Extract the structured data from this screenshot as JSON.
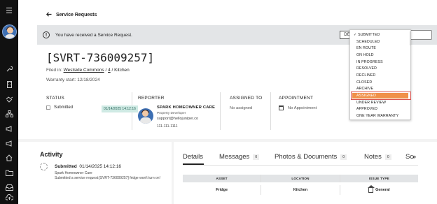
{
  "nav": {
    "items": [
      "menu-icon",
      "wrench-icon",
      "building-icon",
      "handshake-icon",
      "org-chart-icon",
      "megaphone-icon",
      "megaphone-icon",
      "home-icon",
      "folder-icon",
      "inbox-icon",
      "cloud-upload-icon"
    ]
  },
  "header": {
    "back_label": "Service Requests"
  },
  "banner": {
    "message": "You have received a Service Request.",
    "decline_label": "DECLINE"
  },
  "request": {
    "id": "[SVRT-736009257]",
    "filed_in_label": "Filed in:",
    "community": "Westside Commons",
    "unit": "4",
    "room": "Kitchen",
    "warranty_label": "Warranty start:",
    "warranty_date": "12/18/2024"
  },
  "cards": {
    "status_header": "STATUS",
    "status_value": "Submitted",
    "status_date": "01/14/2025 14:12:16",
    "reporter_header": "REPORTER",
    "reporter_name": "SPARK HOMEOWNER CARE",
    "reporter_role": "Property Developer",
    "reporter_email": "support@hellojuniper.co",
    "reporter_phone": "111-111-1111",
    "assigned_header": "ASSIGNED TO",
    "assigned_value": "No assigned",
    "appointment_header": "APPOINTMENT",
    "appointment_value": "No Appointment"
  },
  "activity": {
    "title": "Activity",
    "status": "Submitted",
    "timestamp": "01/14/2025 14:12:16",
    "actor": "Spark Homeowner Care",
    "description": "Submitted a service request:[SVRT-736009257] fridge won't turn on!"
  },
  "tabs": [
    {
      "label": "Details",
      "count": ""
    },
    {
      "label": "Messages",
      "count": "0"
    },
    {
      "label": "Photos & Documents",
      "count": "0"
    },
    {
      "label": "Notes",
      "count": "0"
    },
    {
      "label": "Sc",
      "count": ""
    }
  ],
  "table": {
    "headers": [
      "ASSET",
      "LOCATION",
      "ISSUE TYPE"
    ],
    "row": [
      "Fridge",
      "Kitchen",
      "General"
    ]
  },
  "dropdown": {
    "selected": "SUBMITTED",
    "highlighted": "ASSIGNED",
    "options": [
      "SUBMITTED",
      "SCHEDULED",
      "EN ROUTE",
      "ON HOLD",
      "IN PROGRESS",
      "RESOLVED",
      "DECLINED",
      "CLOSED",
      "ARCHIVE",
      "ASSIGNED",
      "UNDER REVIEW",
      "APPROVED",
      "ONE YEAR WARRANTY"
    ]
  }
}
